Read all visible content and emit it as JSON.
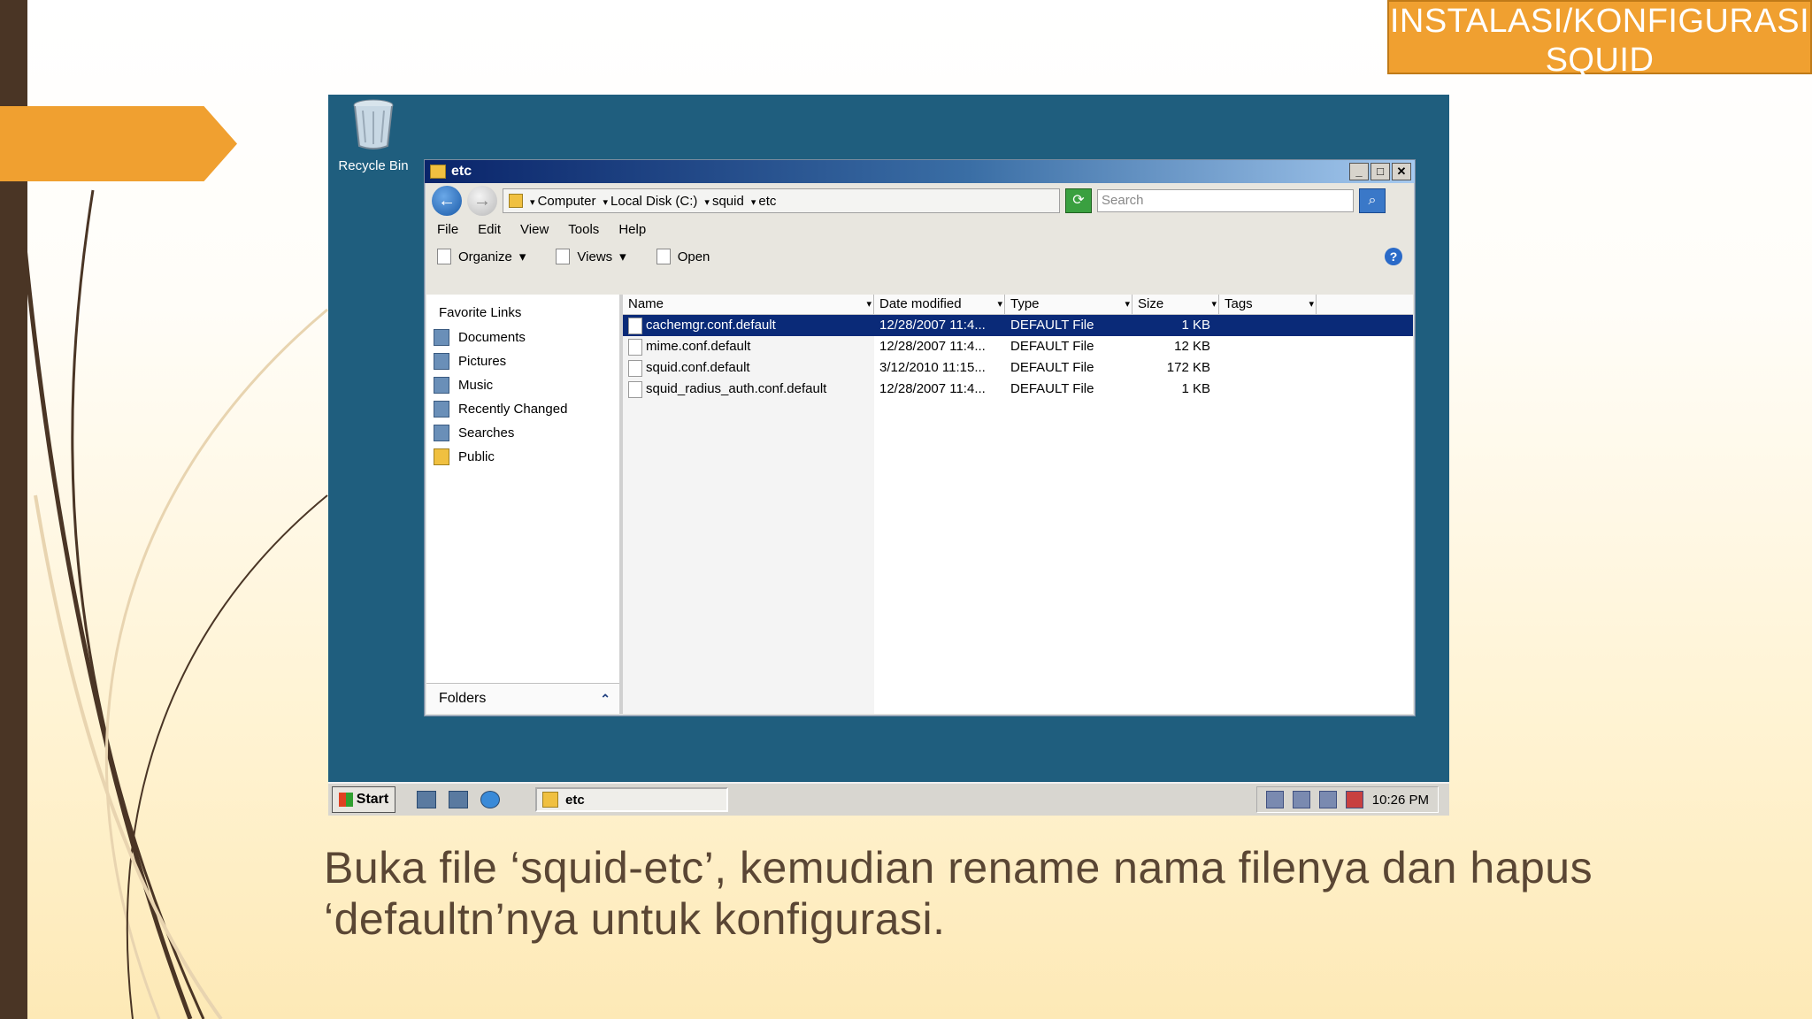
{
  "slide": {
    "title": "INSTALASI/KONFIGURASI SQUID",
    "caption": "Buka file ‘squid-etc’, kemudian rename nama filenya dan hapus ‘defaultn’nya untuk konfigurasi.",
    "accent_color": "#f0a030"
  },
  "desktop": {
    "recycle_bin_label": "Recycle Bin"
  },
  "window": {
    "title": "etc",
    "controls": [
      "_",
      "□",
      "✕"
    ],
    "address": {
      "crumbs": [
        "Computer",
        "Local Disk (C:)",
        "squid",
        "etc"
      ]
    },
    "search_placeholder": "Search",
    "menu": [
      "File",
      "Edit",
      "View",
      "Tools",
      "Help"
    ],
    "toolbar": {
      "organize": "Organize",
      "views": "Views",
      "open": "Open"
    },
    "nav": {
      "heading": "Favorite Links",
      "links": [
        "Documents",
        "Pictures",
        "Music",
        "Recently Changed",
        "Searches",
        "Public"
      ],
      "folders_label": "Folders"
    },
    "columns": [
      "Name",
      "Date modified",
      "Type",
      "Size",
      "Tags"
    ],
    "files": [
      {
        "name": "cachemgr.conf.default",
        "date": "12/28/2007 11:4...",
        "type": "DEFAULT File",
        "size": "1 KB"
      },
      {
        "name": "mime.conf.default",
        "date": "12/28/2007 11:4...",
        "type": "DEFAULT File",
        "size": "12 KB"
      },
      {
        "name": "squid.conf.default",
        "date": "3/12/2010 11:15...",
        "type": "DEFAULT File",
        "size": "172 KB"
      },
      {
        "name": "squid_radius_auth.conf.default",
        "date": "12/28/2007 11:4...",
        "type": "DEFAULT File",
        "size": "1 KB"
      }
    ]
  },
  "taskbar": {
    "start": "Start",
    "task": "etc",
    "clock": "10:26 PM"
  }
}
